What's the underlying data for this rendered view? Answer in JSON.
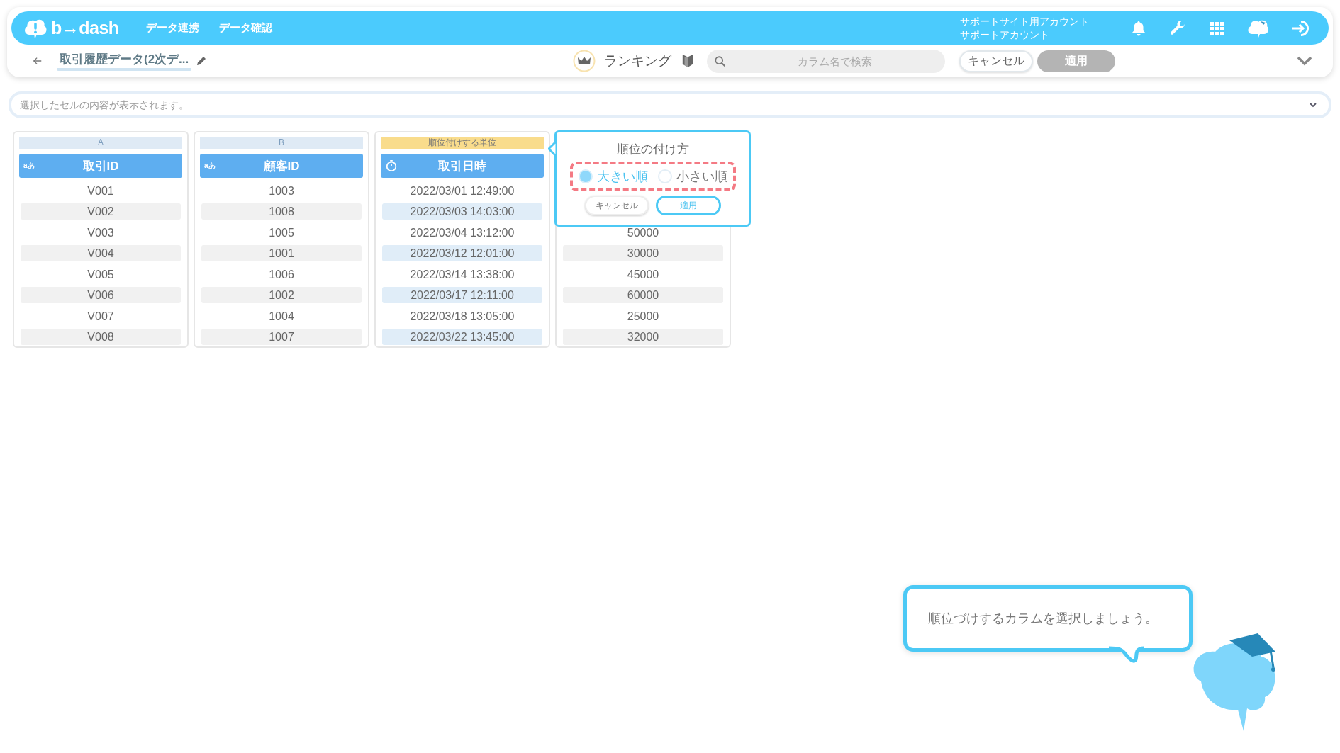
{
  "header": {
    "logo_text": "b→dash",
    "nav": [
      {
        "label": "データ連携"
      },
      {
        "label": "データ確認"
      }
    ],
    "account": [
      "サポートサイト用アカウント",
      "サポートアカウント"
    ]
  },
  "toolbar": {
    "title": "取引履歴データ(2次デ...",
    "mode": "ランキング",
    "search": {
      "placeholder": "カラム名で検索"
    },
    "cancel": {
      "label": "キャンセル"
    },
    "apply": {
      "label": "適用",
      "disabled": true
    }
  },
  "cell_bar": {
    "placeholder": "選択したセルの内容が表示されます。"
  },
  "columns": [
    {
      "letter": "A",
      "selected": false,
      "kind": "string",
      "type_label": "aあ",
      "name": "取引ID",
      "cells": [
        "V001",
        "V002",
        "V003",
        "V004",
        "V005",
        "V006",
        "V007",
        "V008"
      ]
    },
    {
      "letter": "B",
      "selected": false,
      "kind": "string",
      "type_label": "aあ",
      "name": "顧客ID",
      "cells": [
        "1003",
        "1008",
        "1005",
        "1001",
        "1006",
        "1002",
        "1004",
        "1007"
      ]
    },
    {
      "letter": "順位付けする単位",
      "selected": true,
      "kind": "datetime",
      "name": "取引日時",
      "cells": [
        "2022/03/01 12:49:00",
        "2022/03/03 14:03:00",
        "2022/03/04 13:12:00",
        "2022/03/12 12:01:00",
        "2022/03/14 13:38:00",
        "2022/03/17 12:11:00",
        "2022/03/18 13:05:00",
        "2022/03/22 13:45:00"
      ]
    },
    {
      "cells": [
        null,
        null,
        "50000",
        "30000",
        "45000",
        "60000",
        "25000",
        "32000"
      ]
    }
  ],
  "rank_popup": {
    "title": "順位の付け方",
    "highlighted": true,
    "options": [
      {
        "label": "大きい順",
        "selected": true
      },
      {
        "label": "小さい順",
        "selected": false
      }
    ],
    "cancel": "キャンセル",
    "apply": "適用"
  },
  "assistant": {
    "message": "順位づけするカラムを選択しましょう。"
  }
}
